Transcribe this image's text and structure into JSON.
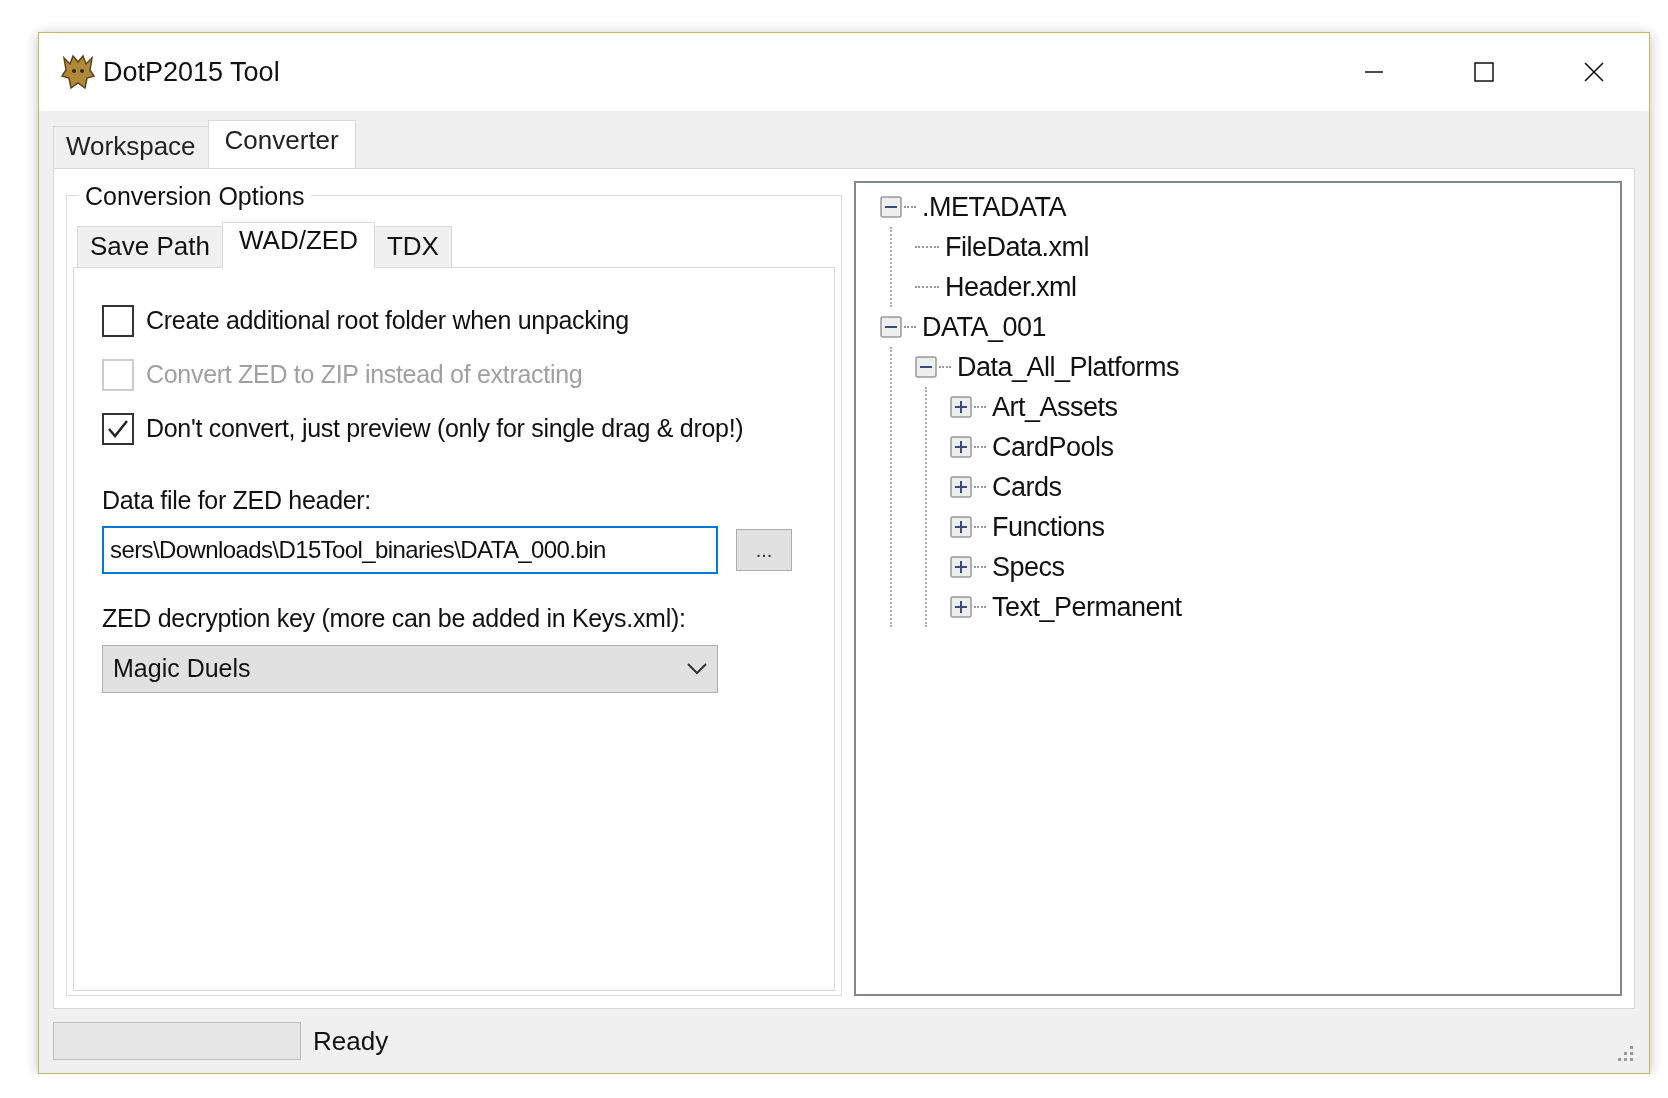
{
  "window": {
    "title": "DotP2015 Tool"
  },
  "tabs": [
    {
      "label": "Workspace",
      "selected": false
    },
    {
      "label": "Converter",
      "selected": true
    }
  ],
  "conversion_options": {
    "title": "Conversion Options",
    "tabs": [
      {
        "label": "Save Path",
        "selected": false
      },
      {
        "label": "WAD/ZED",
        "selected": true
      },
      {
        "label": "TDX",
        "selected": false
      }
    ],
    "checkboxes": [
      {
        "label": "Create additional root folder when unpacking",
        "checked": false,
        "disabled": false
      },
      {
        "label": "Convert ZED to ZIP instead of extracting",
        "checked": false,
        "disabled": true
      },
      {
        "label": "Don't convert, just preview (only for single drag & drop!)",
        "checked": true,
        "disabled": false
      }
    ],
    "data_file": {
      "label": "Data file for ZED header:",
      "value": "sers\\Downloads\\D15Tool_binaries\\DATA_000.bin",
      "browse_button": "..."
    },
    "decryption_key": {
      "label": "ZED decryption key (more can be added in Keys.xml):",
      "value": "Magic Duels"
    }
  },
  "tree": [
    {
      "label": ".METADATA",
      "expanded": true,
      "children": [
        {
          "label": "FileData.xml"
        },
        {
          "label": "Header.xml"
        }
      ]
    },
    {
      "label": "DATA_001",
      "expanded": true,
      "children": [
        {
          "label": "Data_All_Platforms",
          "expanded": true,
          "children": [
            {
              "label": "Art_Assets",
              "expanded": false
            },
            {
              "label": "CardPools",
              "expanded": false
            },
            {
              "label": "Cards",
              "expanded": false
            },
            {
              "label": "Functions",
              "expanded": false
            },
            {
              "label": "Specs",
              "expanded": false
            },
            {
              "label": "Text_Permanent",
              "expanded": false
            }
          ]
        }
      ]
    }
  ],
  "status_bar": {
    "progress": {
      "level": 0
    },
    "text": "Ready"
  }
}
